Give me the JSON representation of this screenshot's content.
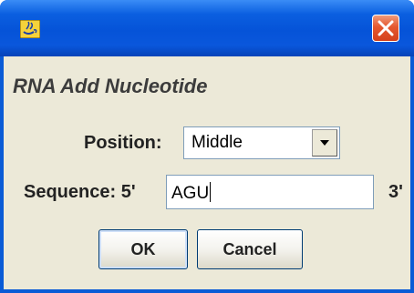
{
  "window": {
    "app_icon": "java-cup-icon",
    "close_icon": "close-icon",
    "accent_color": "#0a5bd6",
    "close_color": "#e5582f"
  },
  "dialog": {
    "title": "RNA Add Nucleotide",
    "position": {
      "label": "Position:",
      "selected": "Middle",
      "arrow_icon": "chevron-down-icon"
    },
    "sequence": {
      "label": "Sequence: 5'",
      "value": "AGU",
      "suffix": "3'"
    },
    "buttons": {
      "ok": "OK",
      "cancel": "Cancel"
    }
  }
}
